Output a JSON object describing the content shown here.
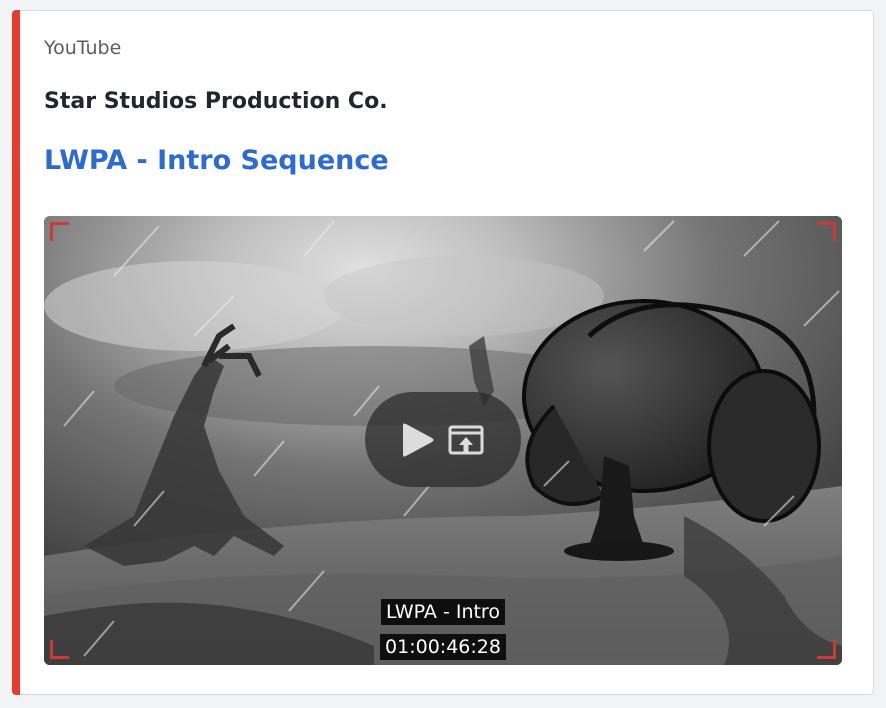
{
  "embed": {
    "provider": "YouTube",
    "author": "Star Studios Production Co.",
    "title": "LWPA - Intro Sequence",
    "accent_color": "#e53b30",
    "title_color": "#2d6bd1"
  },
  "video": {
    "caption_title": "LWPA - Intro",
    "timecode": "01:00:46:28",
    "controls": {
      "play_icon": "play-icon",
      "popout_icon": "open-external-icon"
    }
  }
}
